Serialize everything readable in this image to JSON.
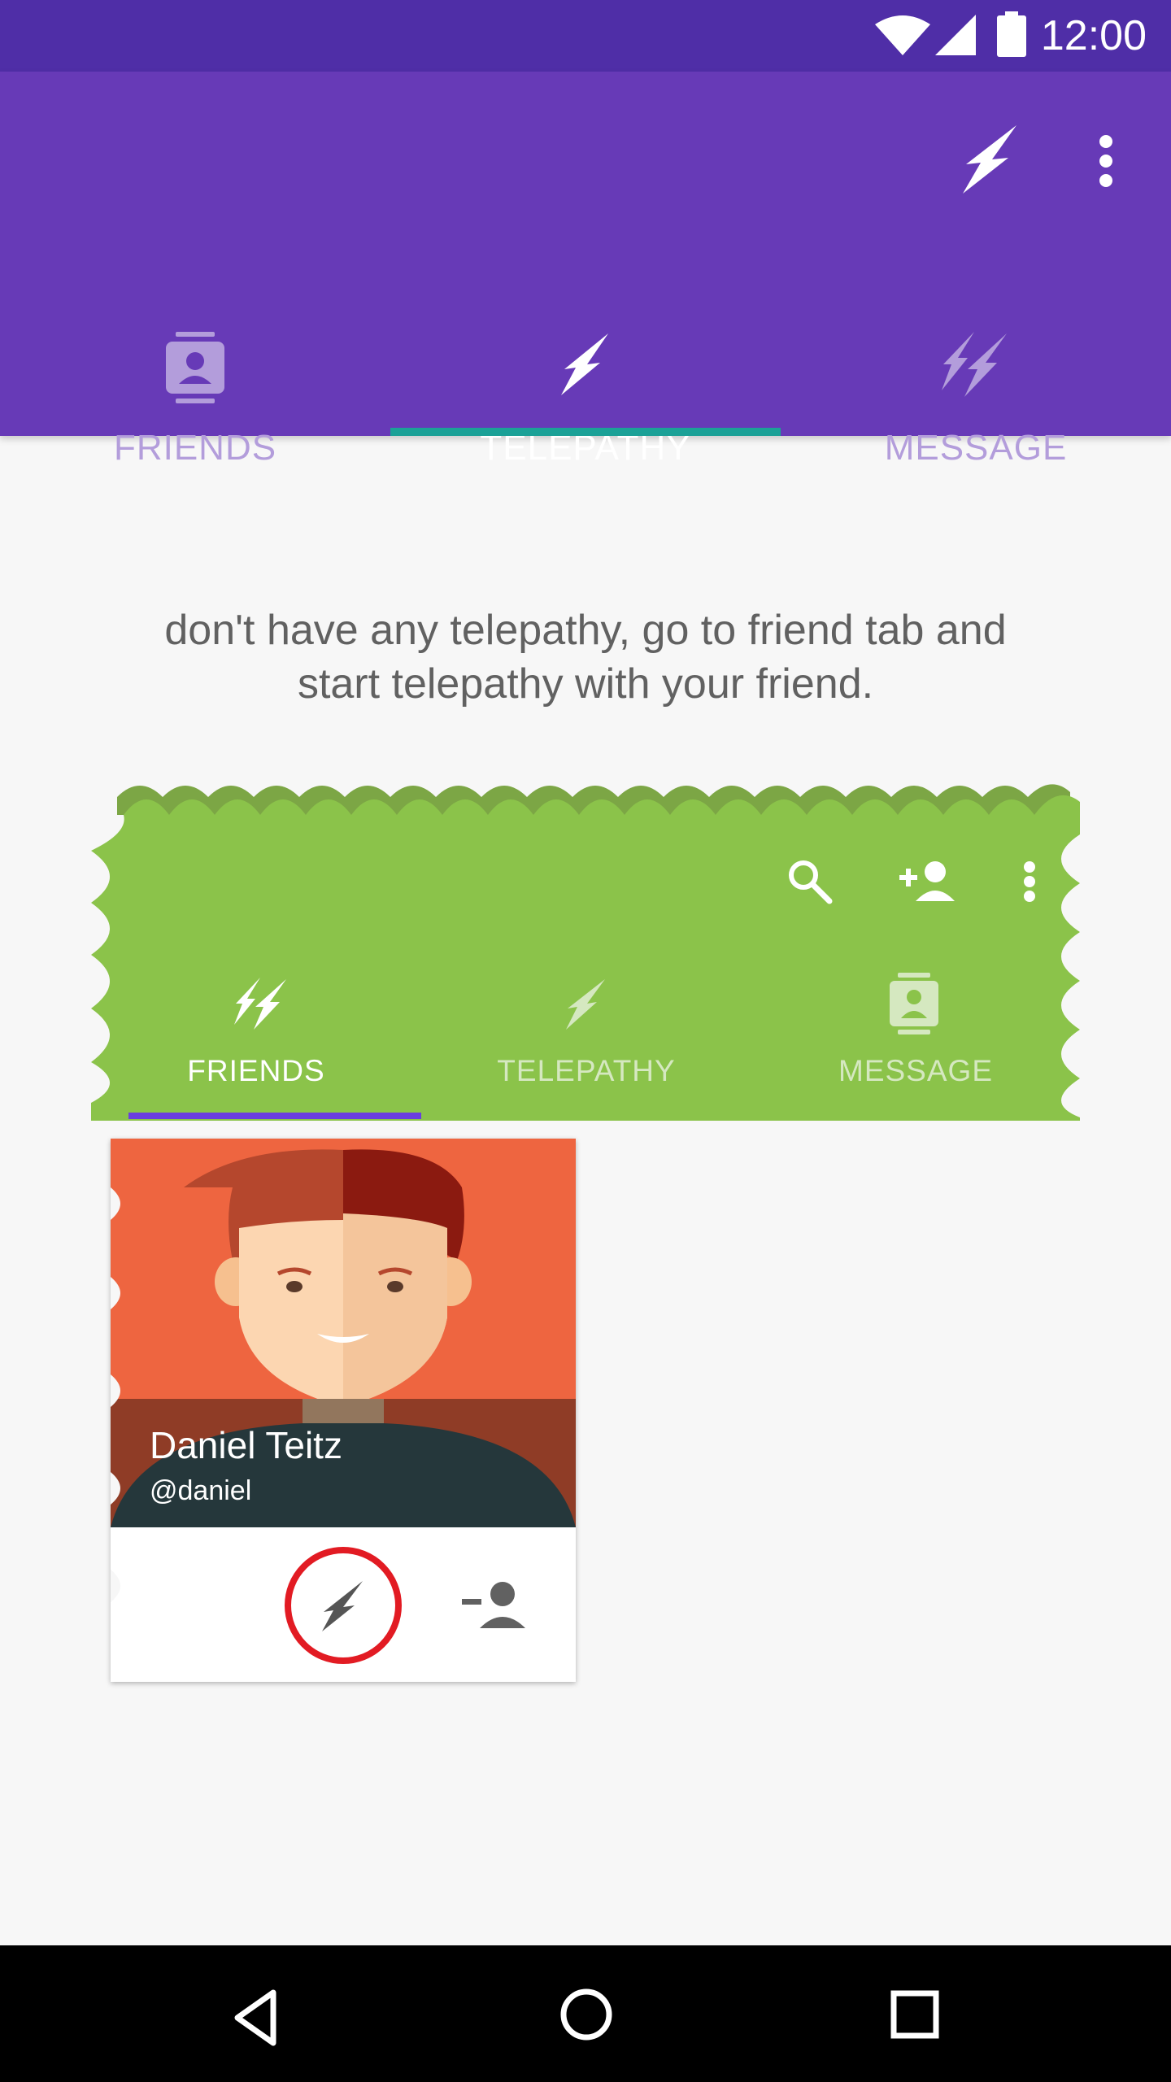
{
  "status_bar": {
    "time": "12:00",
    "icons": [
      "wifi-icon",
      "signal-icon",
      "battery-icon"
    ]
  },
  "app_bar": {
    "actions": [
      "telepathy-bolt-icon",
      "more-vert-icon"
    ],
    "tabs": [
      {
        "label": "FRIENDS",
        "icon": "contact-card-icon",
        "selected": false
      },
      {
        "label": "TELEPATHY",
        "icon": "bolt-icon",
        "selected": true
      },
      {
        "label": "MESSAGE",
        "icon": "double-bolt-icon",
        "selected": false
      }
    ]
  },
  "empty_state": {
    "line1": "don't have any telepathy, go to friend tab and",
    "line2": "start telepathy with your friend."
  },
  "preview": {
    "actions": [
      "search-icon",
      "person-add-icon",
      "more-vert-icon"
    ],
    "tabs": [
      {
        "label": "FRIENDS",
        "icon": "double-bolt-icon",
        "selected": true
      },
      {
        "label": "TELEPATHY",
        "icon": "bolt-icon",
        "selected": false
      },
      {
        "label": "MESSAGE",
        "icon": "contact-card-icon",
        "selected": false
      }
    ]
  },
  "friend_card": {
    "name": "Daniel Teitz",
    "handle": "@daniel",
    "actions": [
      "telepathy-bolt-icon",
      "remove-friend-icon"
    ]
  },
  "nav_bar": {
    "buttons": [
      "back-icon",
      "home-icon",
      "recents-icon"
    ]
  },
  "colors": {
    "primary": "#673ab7",
    "primary_dark": "#4f2ea7",
    "accent": "#1ba197",
    "preview_green": "#8bc34a",
    "card_photo": "#ee6540",
    "highlight_circle": "#e21b23"
  }
}
